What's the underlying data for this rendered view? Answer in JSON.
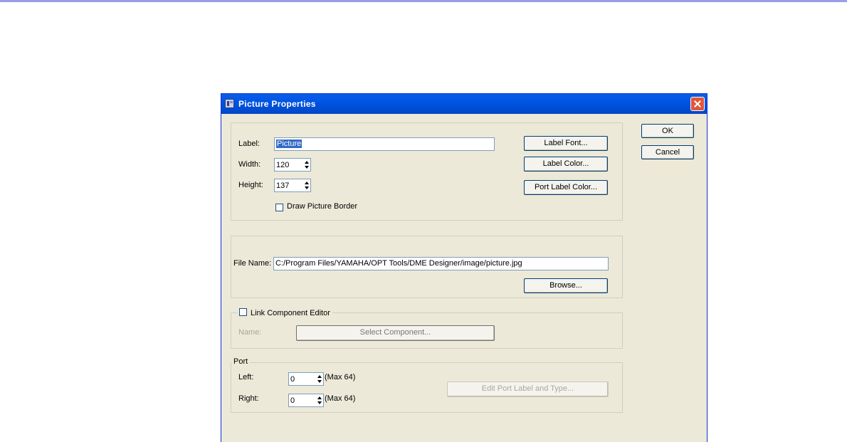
{
  "window": {
    "title": "Picture Properties"
  },
  "buttons": {
    "ok": "OK",
    "cancel": "Cancel",
    "label_font": "Label Font...",
    "label_color": "Label Color...",
    "port_label_color": "Port Label Color...",
    "browse": "Browse...",
    "select_component": "Select Component...",
    "edit_port": "Edit Port Label and Type..."
  },
  "general": {
    "label_caption": "Label:",
    "label_value": "Picture",
    "width_caption": "Width:",
    "width_value": "120",
    "height_caption": "Height:",
    "height_value": "137",
    "draw_border": "Draw Picture Border",
    "draw_border_checked": false
  },
  "file": {
    "caption": "File Name:",
    "value": "C:/Program Files/YAMAHA/OPT Tools/DME Designer/image/picture.jpg"
  },
  "link": {
    "legend": "Link Component Editor",
    "checked": false,
    "name_caption": "Name:"
  },
  "port": {
    "legend": "Port",
    "left_caption": "Left:",
    "left_value": "0",
    "left_max": "(Max 64)",
    "right_caption": "Right:",
    "right_value": "0",
    "right_max": "(Max 64)"
  },
  "colors": {
    "titlebar": "#0054e3",
    "dialog_bg": "#ece9d8",
    "selection": "#316ac5",
    "close": "#e0563b"
  }
}
